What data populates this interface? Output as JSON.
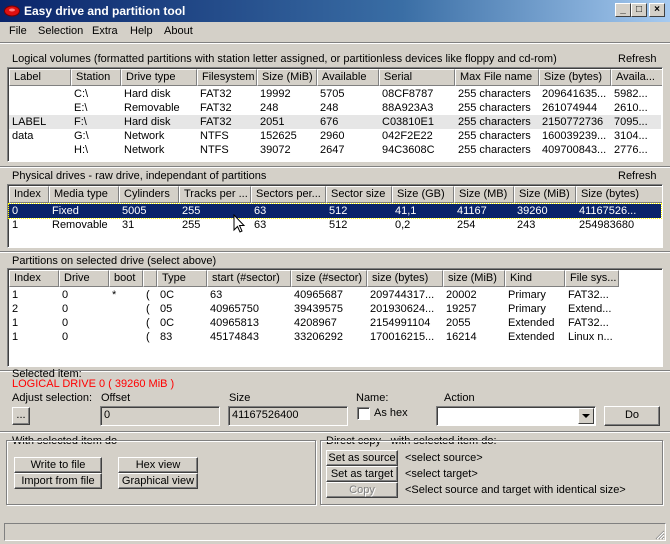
{
  "window": {
    "title": "Easy drive and partition tool"
  },
  "menu": [
    "File",
    "Selection",
    "Extra",
    "Help",
    "About"
  ],
  "logical": {
    "title": "Logical volumes (formatted partitions with station letter assigned, or partitionless devices like floppy and cd-rom)",
    "refresh": "Refresh",
    "columns": [
      "Label",
      "Station",
      "Drive type",
      "Filesystem",
      "Size (MiB)",
      "Available",
      "Serial",
      "Max File name",
      "Size (bytes)",
      "Availa..."
    ],
    "rows": [
      [
        "",
        "C:\\",
        "Hard disk",
        "FAT32",
        "19992",
        "5705",
        "08CF8787",
        "255 characters",
        "209641635...",
        "5982..."
      ],
      [
        "",
        "E:\\",
        "Removable",
        "FAT32",
        "248",
        "248",
        "88A923A3",
        "255 characters",
        "261074944",
        "2610..."
      ],
      [
        "LABEL",
        "F:\\",
        "Hard disk",
        "FAT32",
        "2051",
        "676",
        "C03810E1",
        "255 characters",
        "2150772736",
        "7095..."
      ],
      [
        "data",
        "G:\\",
        "Network",
        "NTFS",
        "152625",
        "2960",
        "042F2E22",
        "255 characters",
        "160039239...",
        "3104..."
      ],
      [
        "",
        "H:\\",
        "Network",
        "NTFS",
        "39072",
        "2647",
        "94C3608C",
        "255 characters",
        "409700843...",
        "2776..."
      ]
    ]
  },
  "physical": {
    "title": "Physical drives - raw drive, independant of partitions",
    "refresh": "Refresh",
    "columns": [
      "Index",
      "Media type",
      "Cylinders",
      "Tracks per ...",
      "Sectors per...",
      "Sector size",
      "Size (GB)",
      "Size (MB)",
      "Size (MiB)",
      "Size (bytes)"
    ],
    "rows": [
      [
        "0",
        "Fixed",
        "5005",
        "255",
        "63",
        "512",
        "41,1",
        "41167",
        "39260",
        "41167526..."
      ],
      [
        "1",
        "Removable",
        "31",
        "255",
        "63",
        "512",
        "0,2",
        "254",
        "243",
        "254983680"
      ]
    ]
  },
  "partitions": {
    "title": "Partitions on selected drive (select above)",
    "columns": [
      "Index",
      "Drive",
      "boot",
      "",
      "Type",
      "start (#sector)",
      "size (#sector)",
      "size (bytes)",
      "size (MiB)",
      "Kind",
      "File sys..."
    ],
    "rows": [
      [
        "1",
        "0",
        "*",
        "(",
        "0C",
        "63",
        "40965687",
        "209744317...",
        "20002",
        "Primary",
        "FAT32..."
      ],
      [
        "2",
        "0",
        "",
        "(",
        "05",
        "40965750",
        "39439575",
        "201930624...",
        "19257",
        "Primary",
        "Extend..."
      ],
      [
        "1",
        "0",
        "",
        "(",
        "0C",
        "40965813",
        "4208967",
        "2154991104",
        "2055",
        "Extended",
        "FAT32..."
      ],
      [
        "1",
        "0",
        "",
        "(",
        "83",
        "45174843",
        "33206292",
        "170016215...",
        "16214",
        "Extended",
        "Linux n..."
      ]
    ]
  },
  "selected": {
    "title": "Selected item:",
    "value": "LOGICAL DRIVE 0  ( 39260 MiB )",
    "value_color": "#ff0000",
    "adjust_label": "Adjust selection:",
    "offset_label": "Offset",
    "offset_value": "0",
    "size_label": "Size",
    "size_value": "41167526400",
    "name_label": "Name:",
    "ashex_label": "As hex",
    "action_label": "Action",
    "action_value": "",
    "ellipsis": "...",
    "do": "Do"
  },
  "withsel": {
    "title": "With selected item do",
    "write": "Write to file",
    "import": "Import from file",
    "hex": "Hex view",
    "graph": "Graphical view"
  },
  "direct": {
    "title": "Direct copy - with selected item do:",
    "set_source": "Set as source",
    "set_target": "Set as target",
    "copy": "Copy",
    "source_text": "<select source>",
    "target_text": "<select target>",
    "copy_text": "<Select source and target with identical size>"
  },
  "colors": {
    "selection": "#0a246a",
    "face": "#d4d0c8"
  }
}
